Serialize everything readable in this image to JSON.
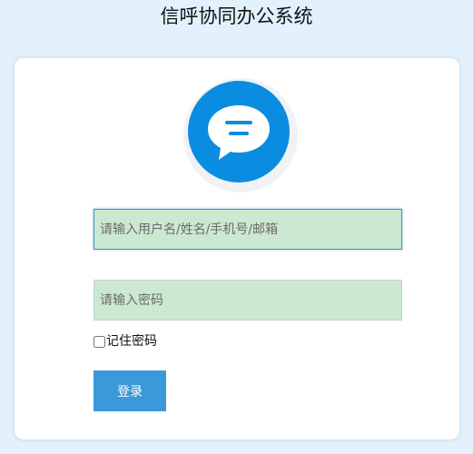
{
  "app": {
    "title": "信呼协同办公系统"
  },
  "logo": {
    "icon": "chat-bubble-icon"
  },
  "form": {
    "username_placeholder": "请输入用户名/姓名/手机号/邮箱",
    "username_value": "",
    "password_placeholder": "请输入密码",
    "password_value": "",
    "remember_label": "记住密码",
    "remember_checked": false,
    "login_label": "登录"
  },
  "colors": {
    "page_background": "#e2f1fb",
    "card_background": "#ffffff",
    "logo_accent": "#0a8de0",
    "field_background": "#cce8d0",
    "button_background": "#3a9ad9",
    "button_text": "#ffffff"
  }
}
